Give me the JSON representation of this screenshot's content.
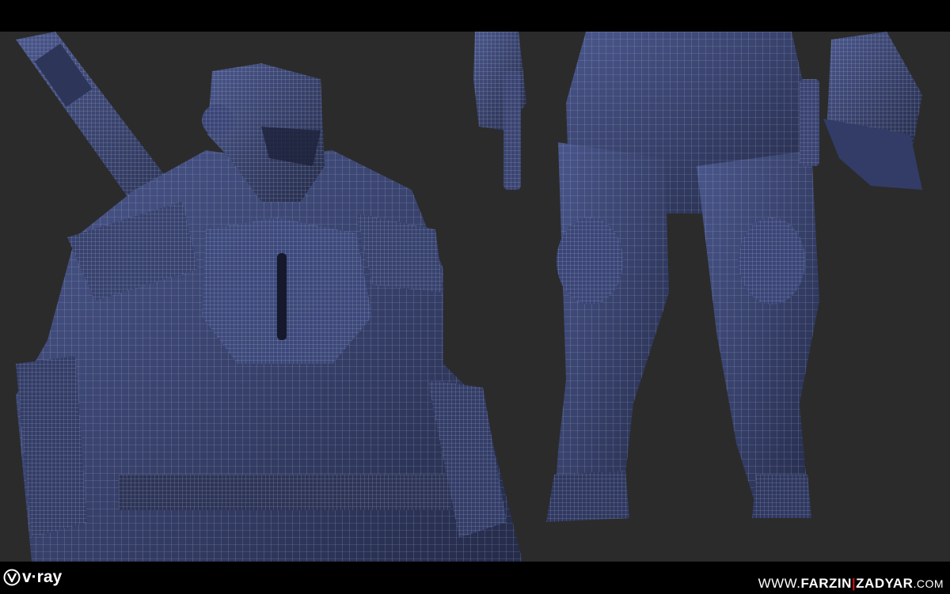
{
  "logo": {
    "brand": "v·ray",
    "mark_icon": "vray-v-icon"
  },
  "credit": {
    "prefix": "WWW.",
    "first": "FARZIN",
    "separator": "|",
    "last": "ZADYAR",
    "suffix": ".COM"
  },
  "colors": {
    "background": "#2b2b2b",
    "armor": "#35406a",
    "wire": "#c8cbd6",
    "accent": "#d01010"
  }
}
